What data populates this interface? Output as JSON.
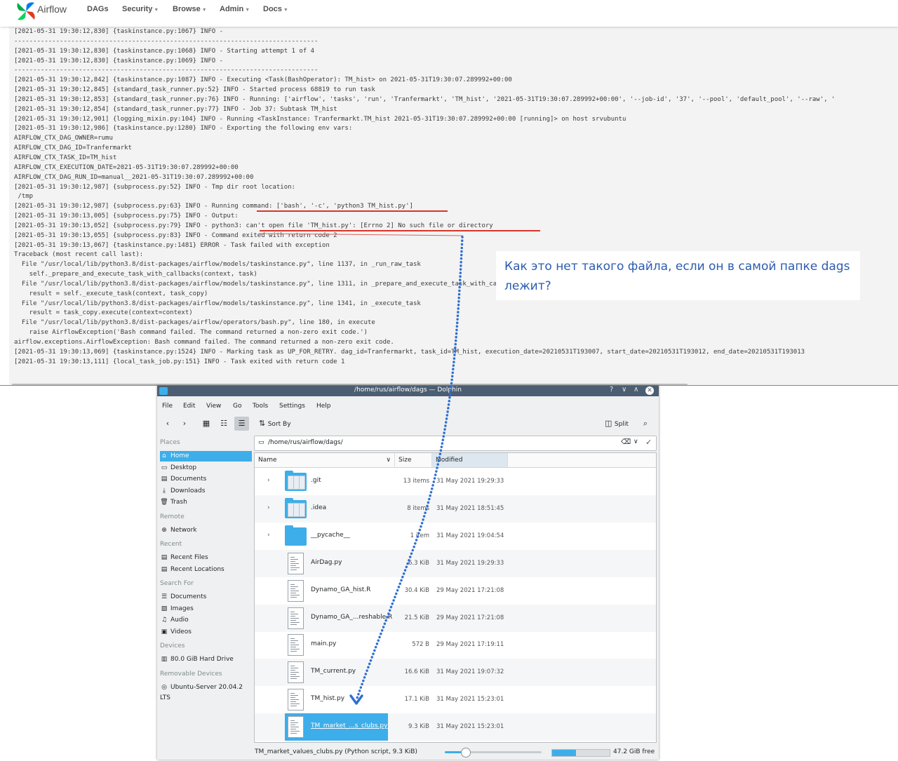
{
  "airflow": {
    "brand": "Airflow",
    "menu": [
      {
        "label": "DAGs",
        "caret": false
      },
      {
        "label": "Security",
        "caret": true
      },
      {
        "label": "Browse",
        "caret": true
      },
      {
        "label": "Admin",
        "caret": true
      },
      {
        "label": "Docs",
        "caret": true
      }
    ],
    "log_lines": [
      "[2021-05-31 19:30:12,830] {taskinstance.py:1067} INFO -",
      "--------------------------------------------------------------------------------",
      "[2021-05-31 19:30:12,830] {taskinstance.py:1068} INFO - Starting attempt 1 of 4",
      "[2021-05-31 19:30:12,830] {taskinstance.py:1069} INFO -",
      "--------------------------------------------------------------------------------",
      "[2021-05-31 19:30:12,842] {taskinstance.py:1087} INFO - Executing <Task(BashOperator): TM_hist> on 2021-05-31T19:30:07.289992+00:00",
      "[2021-05-31 19:30:12,845] {standard_task_runner.py:52} INFO - Started process 68819 to run task",
      "[2021-05-31 19:30:12,853] {standard_task_runner.py:76} INFO - Running: ['airflow', 'tasks', 'run', 'Tranfermarkt', 'TM_hist', '2021-05-31T19:30:07.289992+00:00', '--job-id', '37', '--pool', 'default_pool', '--raw', '",
      "[2021-05-31 19:30:12,854] {standard_task_runner.py:77} INFO - Job 37: Subtask TM_hist",
      "[2021-05-31 19:30:12,901] {logging_mixin.py:104} INFO - Running <TaskInstance: Tranfermarkt.TM_hist 2021-05-31T19:30:07.289992+00:00 [running]> on host srvubuntu",
      "[2021-05-31 19:30:12,986] {taskinstance.py:1280} INFO - Exporting the following env vars:",
      "AIRFLOW_CTX_DAG_OWNER=rumu",
      "AIRFLOW_CTX_DAG_ID=Tranfermarkt",
      "AIRFLOW_CTX_TASK_ID=TM_hist",
      "AIRFLOW_CTX_EXECUTION_DATE=2021-05-31T19:30:07.289992+00:00",
      "AIRFLOW_CTX_DAG_RUN_ID=manual__2021-05-31T19:30:07.289992+00:00",
      "[2021-05-31 19:30:12,987] {subprocess.py:52} INFO - Tmp dir root location:",
      " /tmp",
      "[2021-05-31 19:30:12,987] {subprocess.py:63} INFO - Running command: ['bash', '-c', 'python3 TM_hist.py']",
      "[2021-05-31 19:30:13,005] {subprocess.py:75} INFO - Output:",
      "[2021-05-31 19:30:13,052] {subprocess.py:79} INFO - python3: can't open file 'TM_hist.py': [Errno 2] No such file or directory",
      "[2021-05-31 19:30:13,055] {subprocess.py:83} INFO - Command exited with return code 2",
      "[2021-05-31 19:30:13,067] {taskinstance.py:1481} ERROR - Task failed with exception",
      "Traceback (most recent call last):",
      "  File \"/usr/local/lib/python3.8/dist-packages/airflow/models/taskinstance.py\", line 1137, in _run_raw_task",
      "    self._prepare_and_execute_task_with_callbacks(context, task)",
      "  File \"/usr/local/lib/python3.8/dist-packages/airflow/models/taskinstance.py\", line 1311, in _prepare_and_execute_task_with_callbacks",
      "    result = self._execute_task(context, task_copy)",
      "  File \"/usr/local/lib/python3.8/dist-packages/airflow/models/taskinstance.py\", line 1341, in _execute_task",
      "    result = task_copy.execute(context=context)",
      "  File \"/usr/local/lib/python3.8/dist-packages/airflow/operators/bash.py\", line 180, in execute",
      "    raise AirflowException('Bash command failed. The command returned a non-zero exit code.')",
      "airflow.exceptions.AirflowException: Bash command failed. The command returned a non-zero exit code.",
      "[2021-05-31 19:30:13,069] {taskinstance.py:1524} INFO - Marking task as UP_FOR_RETRY. dag_id=Tranfermarkt, task_id=TM_hist, execution_date=20210531T193007, start_date=20210531T193012, end_date=20210531T193013",
      "[2021-05-31 19:30:13,111] {local_task_job.py:151} INFO - Task exited with return code 1"
    ]
  },
  "annotation": {
    "text": "Как это нет такого файла, если он в самой папке dags лежит?"
  },
  "dolphin": {
    "title": "/home/rus/airflow/dags — Dolphin",
    "title_controls": [
      "?",
      "∨",
      "∧",
      "✕"
    ],
    "menu": [
      "File",
      "Edit",
      "View",
      "Go",
      "Tools",
      "Settings",
      "Help"
    ],
    "toolbar": {
      "sort_label": "Sort By",
      "split_label": "Split"
    },
    "location": "/home/rus/airflow/dags/",
    "places": [
      {
        "type": "header",
        "label": "Places"
      },
      {
        "type": "item",
        "label": "Home",
        "icon": "home-icon",
        "selected": true
      },
      {
        "type": "item",
        "label": "Desktop",
        "icon": "desktop-icon"
      },
      {
        "type": "item",
        "label": "Documents",
        "icon": "documents-icon"
      },
      {
        "type": "item",
        "label": "Downloads",
        "icon": "downloads-icon"
      },
      {
        "type": "item",
        "label": "Trash",
        "icon": "trash-icon"
      },
      {
        "type": "header",
        "label": "Remote"
      },
      {
        "type": "item",
        "label": "Network",
        "icon": "network-icon"
      },
      {
        "type": "header",
        "label": "Recent"
      },
      {
        "type": "item",
        "label": "Recent Files",
        "icon": "recent-files-icon"
      },
      {
        "type": "item",
        "label": "Recent Locations",
        "icon": "recent-locations-icon"
      },
      {
        "type": "header",
        "label": "Search For"
      },
      {
        "type": "item",
        "label": "Documents",
        "icon": "search-documents-icon"
      },
      {
        "type": "item",
        "label": "Images",
        "icon": "images-icon"
      },
      {
        "type": "item",
        "label": "Audio",
        "icon": "audio-icon"
      },
      {
        "type": "item",
        "label": "Videos",
        "icon": "videos-icon"
      },
      {
        "type": "header",
        "label": "Devices"
      },
      {
        "type": "item",
        "label": "80.0 GiB Hard Drive",
        "icon": "hard-drive-icon"
      },
      {
        "type": "header",
        "label": "Removable Devices"
      },
      {
        "type": "item",
        "label": "Ubuntu-Server 20.04.2 LTS",
        "icon": "optical-disc-icon"
      }
    ],
    "columns": [
      "Name",
      "Size",
      "Modified"
    ],
    "files": [
      {
        "name": ".git",
        "size": "13 items",
        "modified": "31 May 2021 19:29:33",
        "kind": "folder-docs",
        "expandable": true
      },
      {
        "name": ".idea",
        "size": "8 items",
        "modified": "31 May 2021 18:51:45",
        "kind": "folder-docs",
        "expandable": true
      },
      {
        "name": "__pycache__",
        "size": "1 item",
        "modified": "31 May 2021 19:04:54",
        "kind": "folder",
        "expandable": true
      },
      {
        "name": "AirDag.py",
        "size": "6.3 KiB",
        "modified": "31 May 2021 19:29:33",
        "kind": "file"
      },
      {
        "name": "Dynamo_GA_hist.R",
        "size": "30.4 KiB",
        "modified": "29 May 2021 17:21:08",
        "kind": "file"
      },
      {
        "name": "Dynamo_GA_...reshable.R",
        "size": "21.5 KiB",
        "modified": "29 May 2021 17:21:08",
        "kind": "file"
      },
      {
        "name": "main.py",
        "size": "572 B",
        "modified": "29 May 2021 17:19:11",
        "kind": "file"
      },
      {
        "name": "TM_current.py",
        "size": "16.6 KiB",
        "modified": "31 May 2021 19:07:32",
        "kind": "file"
      },
      {
        "name": "TM_hist.py",
        "size": "17.1 KiB",
        "modified": "31 May 2021 15:23:01",
        "kind": "file"
      },
      {
        "name": "TM_market_...s_clubs.py",
        "size": "9.3 KiB",
        "modified": "31 May 2021 15:23:01",
        "kind": "file",
        "selected": true
      }
    ],
    "status": {
      "text": "TM_market_values_clubs.py (Python script, 9.3 KiB)",
      "free_space": "47.2 GiB free",
      "used_fraction": 0.41
    }
  }
}
